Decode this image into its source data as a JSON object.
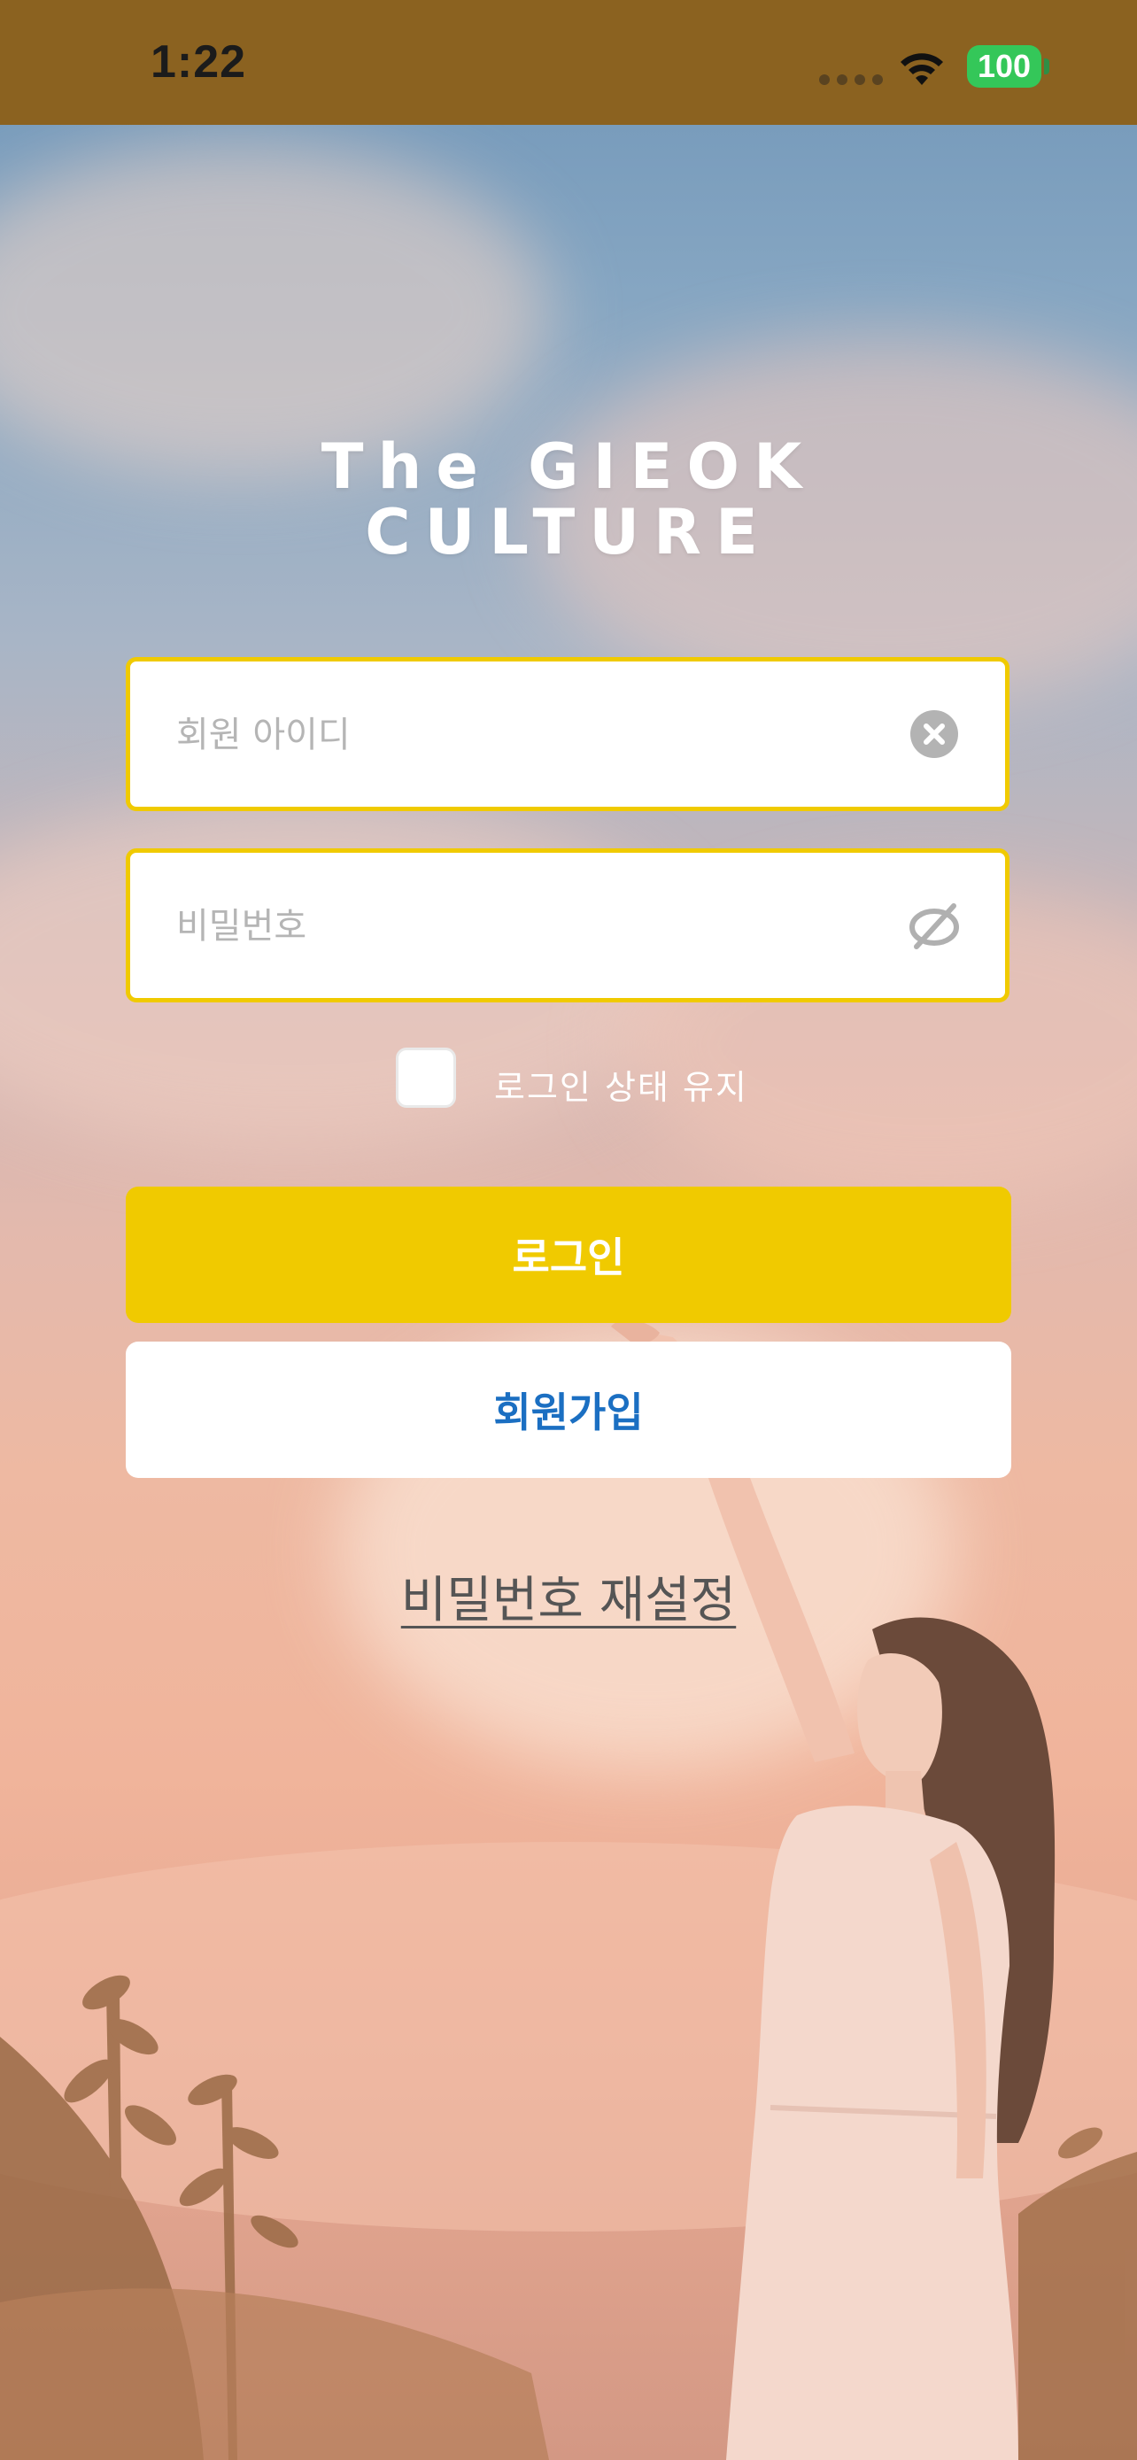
{
  "status_bar": {
    "time": "1:22",
    "battery": "100"
  },
  "brand": {
    "title_line1": "The GIEOK",
    "title_line2": "CULTURE"
  },
  "login_form": {
    "id_placeholder": "회원 아이디",
    "id_value": "",
    "password_placeholder": "비밀번호",
    "password_value": "",
    "remember_label": "로그인 상태 유지",
    "remember_checked": false
  },
  "buttons": {
    "login_label": "로그인",
    "signup_label": "회원가입",
    "reset_password_label": "비밀번호 재설정"
  },
  "colors": {
    "accent": "#f0ca00",
    "status_bar": "#8b6220",
    "signup_text": "#1b6fc2",
    "battery": "#34c759"
  },
  "icons": {
    "id_clear": "clear-icon",
    "password_toggle": "eye-off-icon",
    "wifi": "wifi-icon"
  },
  "background": {
    "description_icon": "sunset-sky-woman-photo"
  }
}
